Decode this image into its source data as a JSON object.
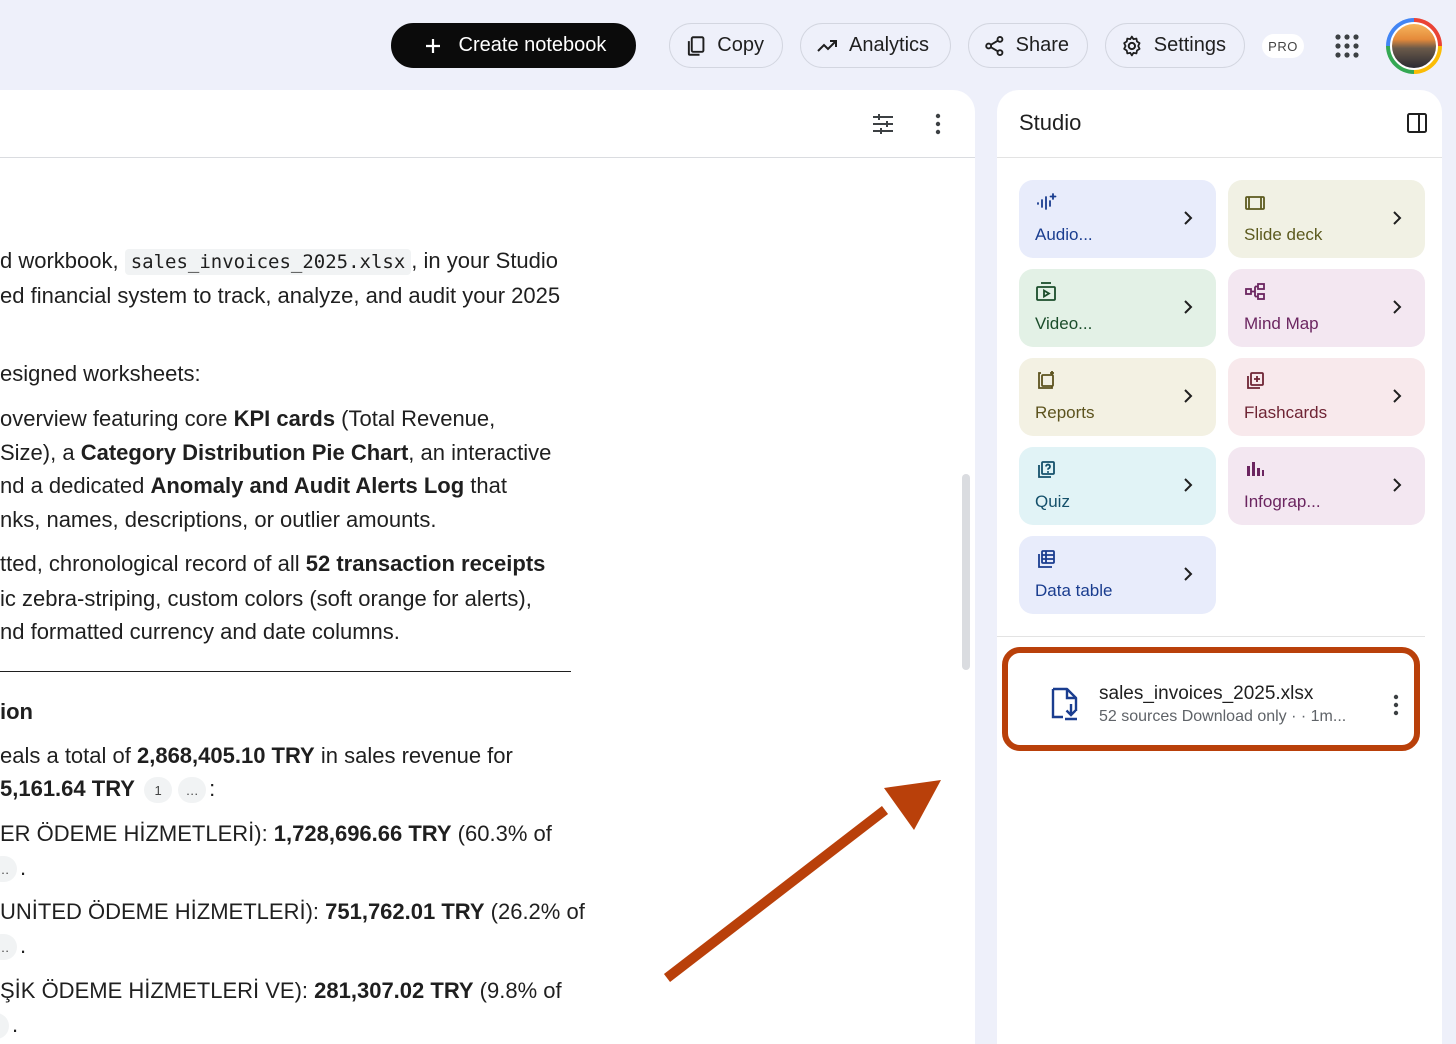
{
  "topbar": {
    "create_label": "Create notebook",
    "copy_label": "Copy",
    "analytics_label": "Analytics",
    "share_label": "Share",
    "settings_label": "Settings",
    "pro_label": "PRO"
  },
  "chat": {
    "l1_a": "d workbook, ",
    "l1_code": "sales_invoices_2025.xlsx",
    "l1_b": ", in your Studio",
    "l2": "ed financial system to track, analyze, and audit your 2025",
    "l3": "esigned worksheets:",
    "l4_a": "overview featuring core ",
    "l4_b": "KPI cards",
    "l4_c": " (Total Revenue,",
    "l5_a": "Size), a ",
    "l5_b": "Category Distribution Pie Chart",
    "l5_c": ", an interactive",
    "l6_a": "nd a dedicated ",
    "l6_b": "Anomaly and Audit Alerts Log",
    "l6_c": " that",
    "l7": "nks, names, descriptions, or outlier amounts.",
    "l8_a": "tted, chronological record of all ",
    "l8_b": "52 transaction receipts",
    "l9": "ic zebra-striping, custom colors (soft orange for alerts),",
    "l10": "nd formatted currency and date columns.",
    "l11": "ion",
    "l12_a": "eals a total of ",
    "l12_b": "2,868,405.10 TRY",
    "l12_c": " in sales revenue for",
    "l13_a": "5,161.64 TRY",
    "l13_cite": "1",
    "l13_ellipsis": "…",
    "l13_c": ":",
    "l14_a": "ER ÖDEME HİZMETLERİ): ",
    "l14_b": "1,728,696.66 TRY",
    "l14_c": " (60.3% of",
    "l15_ellipsis": "…",
    "l15_c": ".",
    "l16_a": "UNİTED ÖDEME HİZMETLERİ): ",
    "l16_b": "751,762.01 TRY",
    "l16_c": " (26.2% of",
    "l17_ellipsis": "…",
    "l17_c": ".",
    "l18_a": "ŞİK ÖDEME HİZMETLERİ VE): ",
    "l18_b": "281,307.02 TRY",
    "l18_c": " (9.8% of",
    "l19_ellipsis": "…",
    "l19_c": "."
  },
  "studio": {
    "title": "Studio",
    "tiles": [
      {
        "label": "Audio...",
        "icon": "audio-wave-icon",
        "bg": "#e8ecfb",
        "fg": "#1a3d8f"
      },
      {
        "label": "Slide deck",
        "icon": "slide-deck-icon",
        "bg": "#f1f1e4",
        "fg": "#5c5a1e"
      },
      {
        "label": "Video...",
        "icon": "video-icon",
        "bg": "#e3f1e6",
        "fg": "#1b4d2b"
      },
      {
        "label": "Mind Map",
        "icon": "mind-map-icon",
        "bg": "#f3e7f1",
        "fg": "#6b2560"
      },
      {
        "label": "Reports",
        "icon": "reports-icon",
        "bg": "#f3f1e3",
        "fg": "#5c531e"
      },
      {
        "label": "Flashcards",
        "icon": "flashcards-icon",
        "bg": "#f8e9ec",
        "fg": "#6e2434"
      },
      {
        "label": "Quiz",
        "icon": "quiz-icon",
        "bg": "#e1f3f6",
        "fg": "#15506b"
      },
      {
        "label": "Infograp...",
        "icon": "infographic-icon",
        "bg": "#f3e7f1",
        "fg": "#6b2560"
      },
      {
        "label": "Data table",
        "icon": "data-table-icon",
        "bg": "#e8ecfb",
        "fg": "#1a3d8f"
      }
    ],
    "source": {
      "title": "sales_invoices_2025.xlsx",
      "meta": "52 sources Download only · · 1m..."
    }
  },
  "colors": {
    "highlight": "#b9400a",
    "arrow": "#b9400a",
    "create_button_bg": "#0b0b0b"
  }
}
